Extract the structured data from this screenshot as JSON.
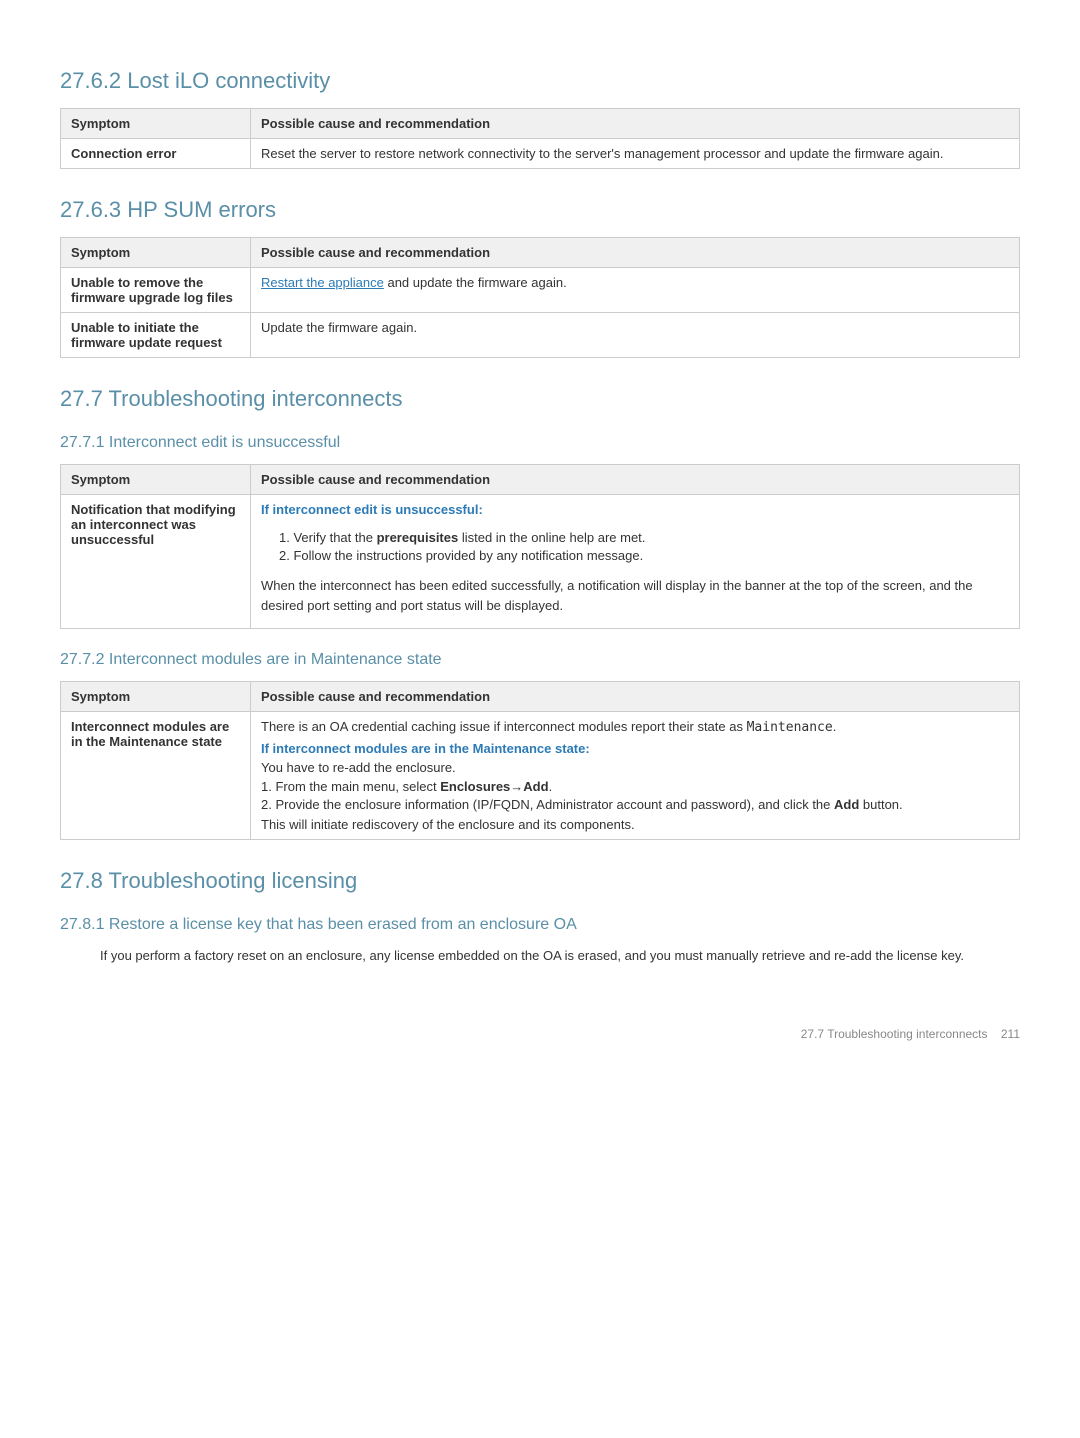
{
  "sections": [
    {
      "id": "27-6-2",
      "title": "27.6.2 Lost iLO connectivity",
      "tables": [
        {
          "headers": [
            "Symptom",
            "Possible cause and recommendation"
          ],
          "rows": [
            {
              "symptom": "Connection error",
              "recommendation_parts": [
                {
                  "type": "text",
                  "content": "Reset the server to restore network connectivity to the server's management processor and update the firmware again."
                }
              ]
            }
          ]
        }
      ]
    },
    {
      "id": "27-6-3",
      "title": "27.6.3 HP SUM errors",
      "tables": [
        {
          "headers": [
            "Symptom",
            "Possible cause and recommendation"
          ],
          "rows": [
            {
              "symptom": "Unable to remove the firmware upgrade log files",
              "recommendation_parts": [
                {
                  "type": "link",
                  "content": "Restart the appliance"
                },
                {
                  "type": "text",
                  "content": " and update the firmware again."
                }
              ]
            },
            {
              "symptom": "Unable to initiate the firmware update request",
              "recommendation_parts": [
                {
                  "type": "text",
                  "content": "Update the firmware again."
                }
              ]
            }
          ]
        }
      ]
    }
  ],
  "section_27_7": {
    "title": "27.7 Troubleshooting interconnects",
    "sub_sections": [
      {
        "id": "27-7-1",
        "title": "27.7.1 Interconnect edit is unsuccessful",
        "table": {
          "headers": [
            "Symptom",
            "Possible cause and recommendation"
          ],
          "rows": [
            {
              "symptom": "Notification that modifying an interconnect was unsuccessful",
              "recommendation": {
                "heading": "If interconnect edit is unsuccessful:",
                "items": [
                  {
                    "type": "numbered",
                    "num": "1.",
                    "bold": "prerequisites",
                    "before": "Verify that the ",
                    "after": " listed in the online help are met."
                  },
                  {
                    "type": "numbered",
                    "num": "2.",
                    "text": "Follow the instructions provided by any notification message."
                  },
                  {
                    "type": "text",
                    "text": "When the interconnect has been edited successfully, a notification will display in the banner at the top of the screen, and the desired port setting and port status will be displayed."
                  }
                ]
              }
            }
          ]
        }
      },
      {
        "id": "27-7-2",
        "title": "27.7.2 Interconnect modules are in Maintenance state",
        "table": {
          "headers": [
            "Symptom",
            "Possible cause and recommendation"
          ],
          "rows": [
            {
              "symptom": "Interconnect modules are in the Maintenance state",
              "recommendation": {
                "intro": "There is an OA credential caching issue if interconnect modules report their state as",
                "mono": "Maintenance",
                "heading": "If interconnect modules are in the Maintenance state:",
                "body1": "You have to re-add the enclosure.",
                "items": [
                  {
                    "num": "1.",
                    "before": "From the main menu, select ",
                    "bold": "Enclosures",
                    "arrow": "→",
                    "bold2": "Add",
                    "after": "."
                  },
                  {
                    "num": "2.",
                    "before": "Provide the enclosure information (IP/FQDN, Administrator account and password), and click the ",
                    "bold": "Add",
                    "after": " button."
                  }
                ],
                "footer": "This will initiate rediscovery of the enclosure and its components."
              }
            }
          ]
        }
      }
    ]
  },
  "section_27_8": {
    "title": "27.8 Troubleshooting licensing",
    "sub_sections": [
      {
        "id": "27-8-1",
        "title": "27.8.1 Restore a license key that has been erased from an enclosure OA",
        "body": "If you perform a factory reset on an enclosure, any license embedded on the OA is erased, and you must manually retrieve and re-add the license key."
      }
    ]
  },
  "footer": {
    "text": "27.7 Troubleshooting interconnects",
    "page": "211"
  }
}
